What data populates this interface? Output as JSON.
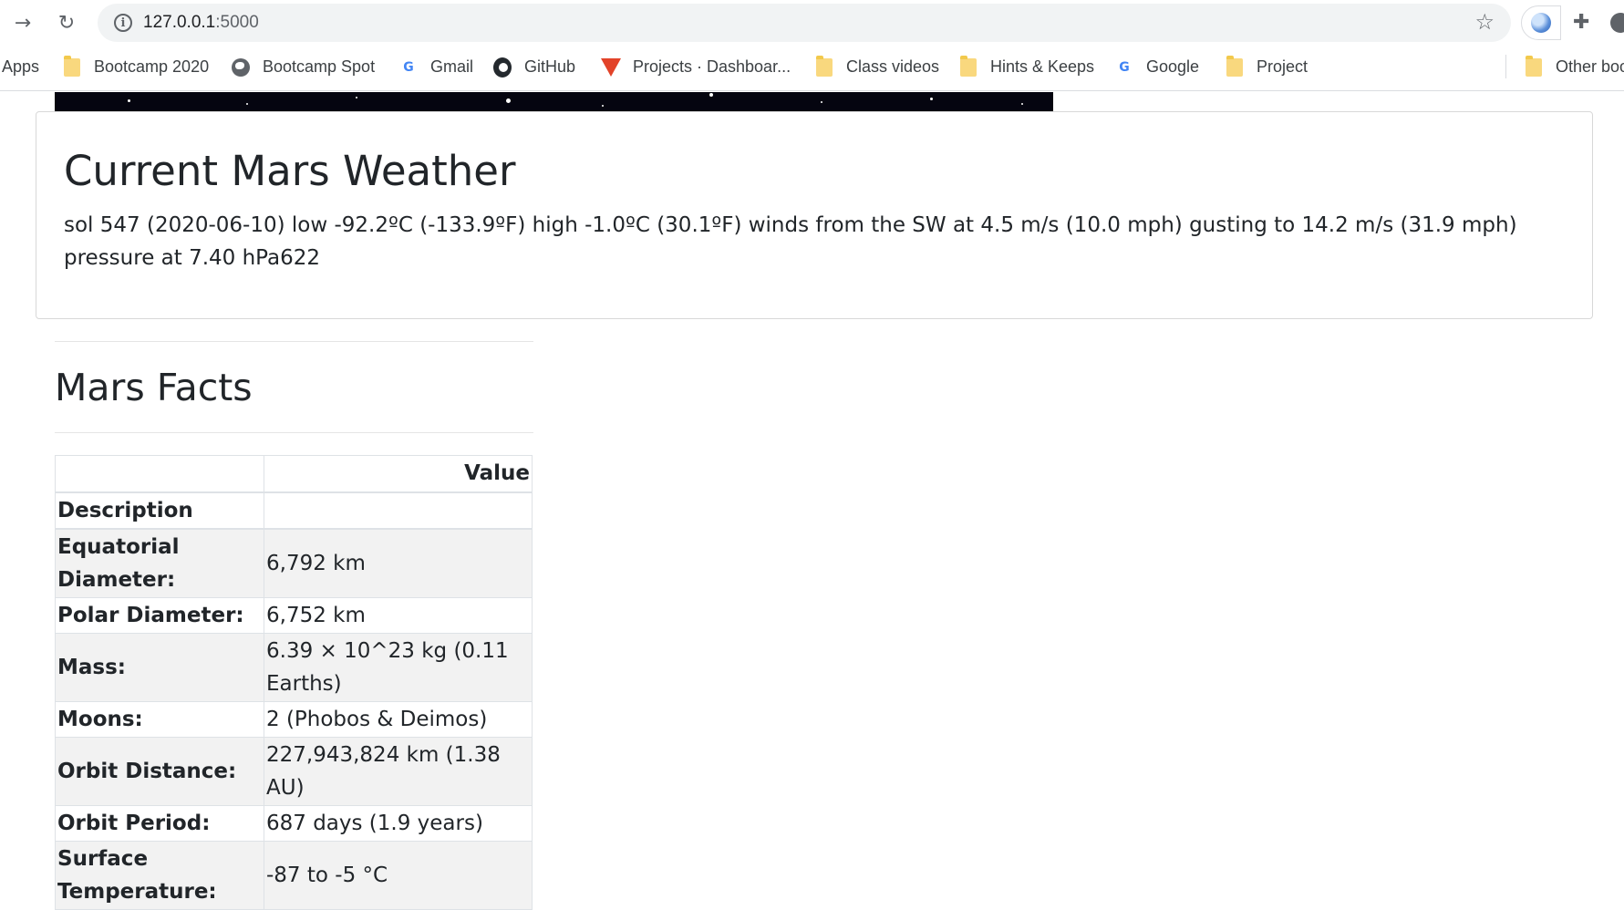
{
  "browser": {
    "url_host": "127.0.0.1",
    "url_port": ":5000",
    "bookmarks": [
      {
        "label": "Apps",
        "icon": "apps-icon"
      },
      {
        "label": "Bootcamp 2020",
        "icon": "folder-icon"
      },
      {
        "label": "Bootcamp Spot",
        "icon": "globe-icon"
      },
      {
        "label": "Gmail",
        "icon": "google-icon"
      },
      {
        "label": "GitHub",
        "icon": "github-icon"
      },
      {
        "label": "Projects · Dashboar...",
        "icon": "gitlab-icon"
      },
      {
        "label": "Class videos",
        "icon": "folder-icon"
      },
      {
        "label": "Hints & Keeps",
        "icon": "folder-icon"
      },
      {
        "label": "Google",
        "icon": "google-icon"
      },
      {
        "label": "Project",
        "icon": "folder-icon"
      },
      {
        "label": "Other boo",
        "icon": "folder-icon"
      }
    ]
  },
  "weather": {
    "title": "Current Mars Weather",
    "text": "sol 547 (2020-06-10) low -92.2ºC (-133.9ºF) high -1.0ºC (30.1ºF) winds from the SW at 4.5 m/s (10.0 mph) gusting to 14.2 m/s (31.9 mph) pressure at 7.40 hPa622"
  },
  "facts": {
    "title": "Mars Facts",
    "header_value": "Value",
    "header_description": "Description",
    "rows": [
      {
        "label": "Equatorial Diameter:",
        "value": "6,792 km"
      },
      {
        "label": "Polar Diameter:",
        "value": "6,752 km"
      },
      {
        "label": "Mass:",
        "value": "6.39 × 10^23 kg (0.11 Earths)"
      },
      {
        "label": "Moons:",
        "value": "2 (Phobos & Deimos)"
      },
      {
        "label": "Orbit Distance:",
        "value": "227,943,824 km (1.38 AU)"
      },
      {
        "label": "Orbit Period:",
        "value": "687 days (1.9 years)"
      },
      {
        "label": "Surface Temperature:",
        "value": "-87 to -5 °C"
      }
    ]
  },
  "colors": {
    "text": "#212529",
    "table_stripe": "#f2f2f2",
    "border": "#dee2e6"
  }
}
